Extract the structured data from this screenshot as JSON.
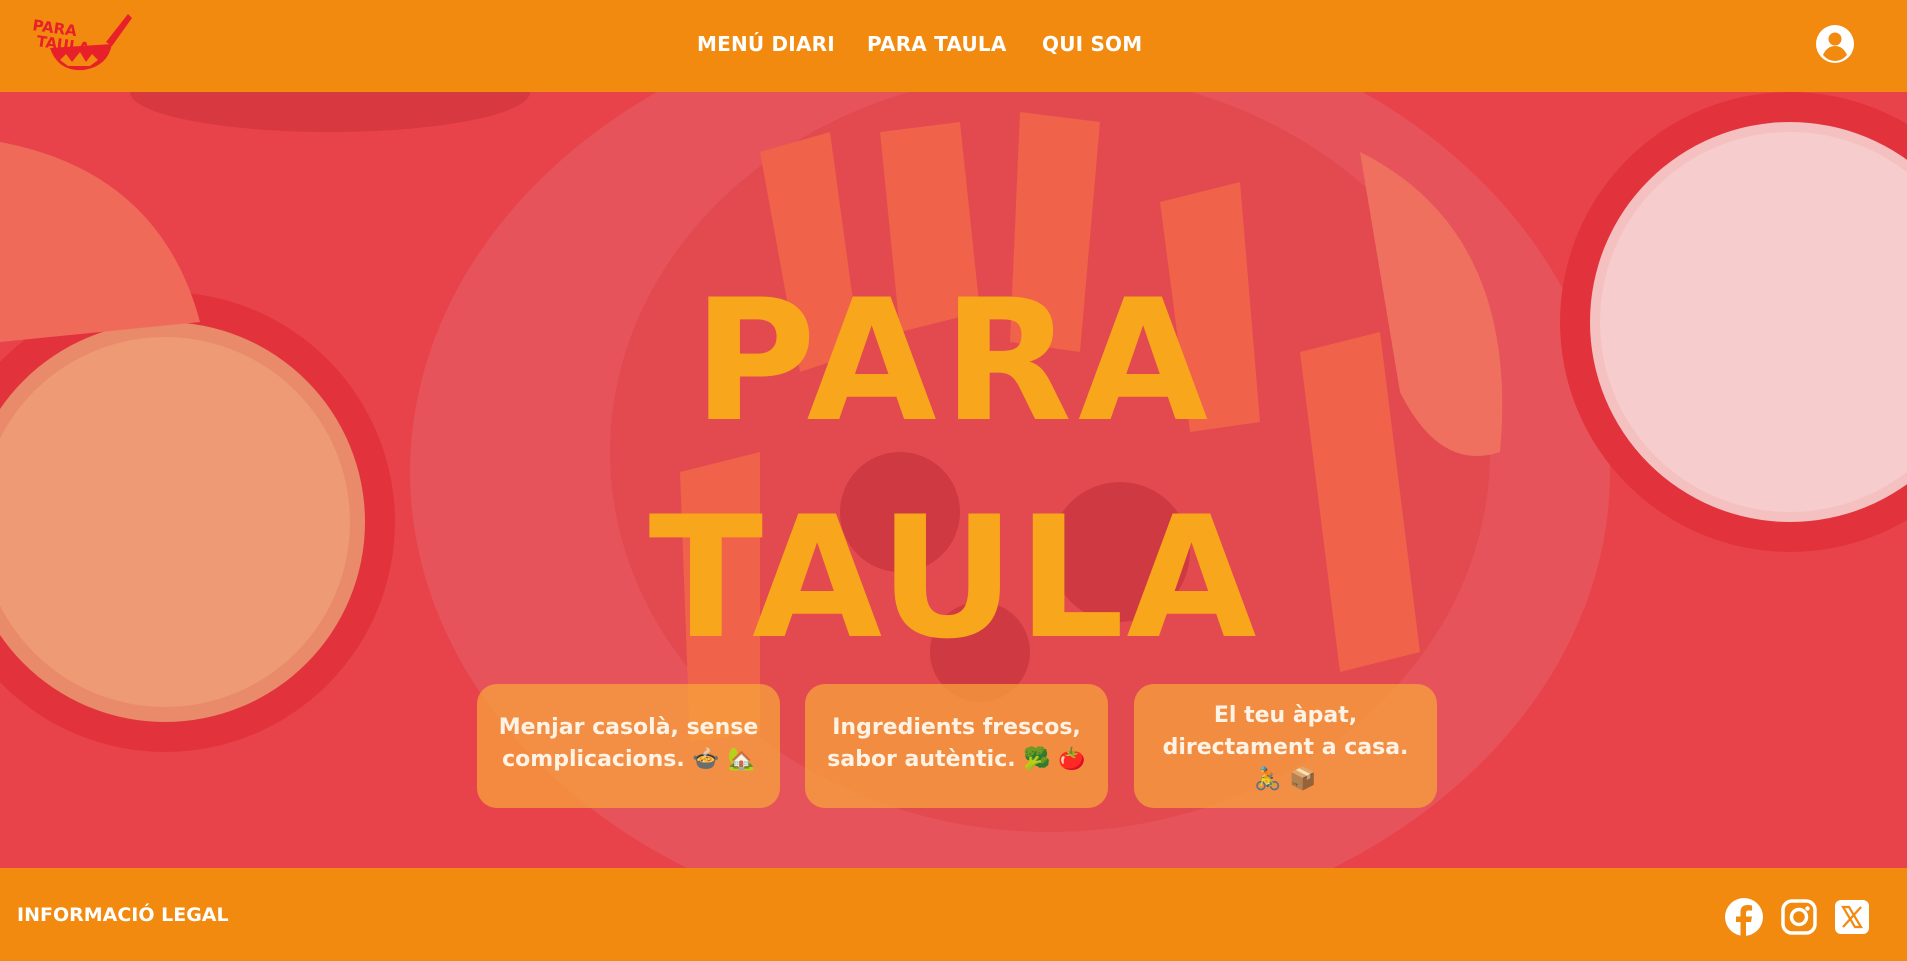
{
  "brand": {
    "logo_line1": "PARA",
    "logo_line2": "TAULA",
    "logo_color": "#e8202a"
  },
  "nav": {
    "items": [
      {
        "label": "MENÚ DIARI"
      },
      {
        "label": "PARA TAULA"
      },
      {
        "label": "QUI SOM"
      }
    ],
    "user_icon": "user-circle-icon"
  },
  "hero": {
    "title_line1": "PARA",
    "title_line2": "TAULA",
    "title_color": "#f8a61c",
    "overlay_color": "#e8434b",
    "cards": [
      {
        "text": "Menjar casolà, sense complicacions. 🍲 🏡"
      },
      {
        "text": "Ingredients frescos, sabor autèntic. 🥦 🍅"
      },
      {
        "text": "El teu àpat, directament a casa. 🚴 📦"
      }
    ]
  },
  "footer": {
    "legal_label": "INFORMACIÓ LEGAL",
    "social": [
      {
        "icon": "facebook-icon"
      },
      {
        "icon": "instagram-icon"
      },
      {
        "icon": "x-twitter-icon"
      }
    ]
  },
  "colors": {
    "primary_orange": "#f28a0f",
    "white": "#ffffff"
  }
}
